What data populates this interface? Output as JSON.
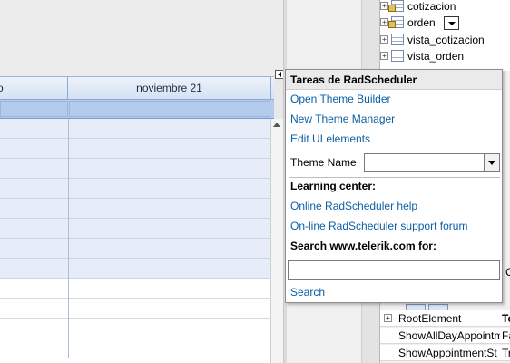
{
  "tree": {
    "items": [
      {
        "label": "cotizacion",
        "locked": true,
        "dropdown": false
      },
      {
        "label": "orden",
        "locked": true,
        "dropdown": true
      },
      {
        "label": "vista_cotizacion",
        "locked": false,
        "dropdown": false
      },
      {
        "label": "vista_orden",
        "locked": false,
        "dropdown": false
      }
    ]
  },
  "scheduler": {
    "header": {
      "first_day_sliver": "o",
      "day_label": "noviembre 21"
    },
    "rows": 12
  },
  "popup": {
    "title": "Tareas de RadScheduler",
    "links": {
      "open_theme_builder": "Open Theme Builder",
      "new_theme_manager": "New Theme Manager",
      "edit_ui_elements": "Edit UI elements"
    },
    "theme_name_label": "Theme Name",
    "theme_name_value": "",
    "learning_center_label": "Learning center:",
    "online_help": "Online RadScheduler help",
    "support_forum": "On-line RadScheduler support forum",
    "search_label": "Search www.telerik.com for:",
    "search_value": "",
    "search_link": "Search"
  },
  "property_grid": {
    "partial_letter": "C",
    "rows": [
      {
        "name": "RootElement",
        "value": "Te",
        "expander": true,
        "bold": true
      },
      {
        "name": "ShowAllDayAppointm",
        "value": "Fa",
        "expander": false,
        "bold": false
      },
      {
        "name": "ShowAppointmentSt",
        "value": "Tr",
        "expander": false,
        "bold": false
      }
    ]
  },
  "colors": {
    "accent_link": "#0b5fa5",
    "header_blue": "#d4e1f3",
    "allday_blue": "#b5cbeb",
    "business_hours": "#e6edf8"
  }
}
